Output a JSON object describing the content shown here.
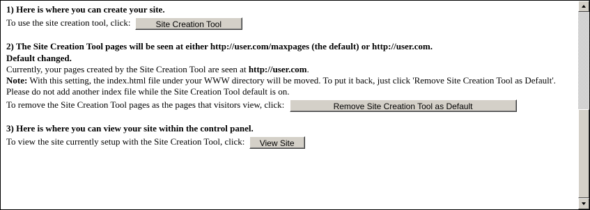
{
  "section1": {
    "heading": "1) Here is where you can create your site.",
    "text": "To use the site creation tool, click:",
    "button_label": "Site Creation Tool"
  },
  "section2": {
    "heading_line1": "2) The Site Creation Tool pages will be seen at either http://user.com/maxpages (the default) or http://user.com.",
    "heading_line2": "Default changed.",
    "current_prefix": "Currently, your pages created by the Site Creation Tool are seen at ",
    "current_url": "http://user.com",
    "current_suffix": ".",
    "note_label": "Note:",
    "note_text": " With this setting, the index.html file under your WWW directory will be moved. To put it back, just click 'Remove Site Creation Tool as Default'.",
    "warning_text": "Please do not add another index file while the Site Creation Tool default is on.",
    "remove_text": "To remove the Site Creation Tool pages as the pages that visitors view, click:",
    "button_label": "Remove Site Creation Tool as Default"
  },
  "section3": {
    "heading": "3) Here is where you can view your site within the control panel.",
    "text": "To view the site currently setup with the Site Creation Tool, click:",
    "button_label": "View Site"
  },
  "colors": {
    "button_face": "#d4d0c8",
    "text": "#000000",
    "background": "#ffffff"
  }
}
